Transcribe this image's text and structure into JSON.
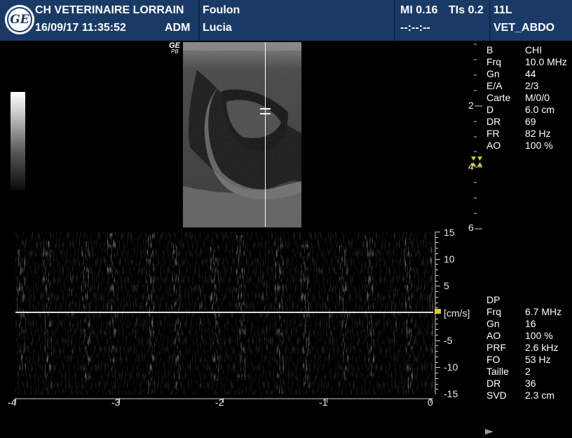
{
  "header": {
    "institution": "CH VETERINAIRE LORRAIN",
    "datetime": "16/09/17 11:35:52",
    "operator": "ADM",
    "patient_last": "Foulon",
    "patient_first": "Lucia",
    "mi_label": "MI 0.16",
    "tis_label": "TIs 0.2",
    "timer": "--:--:--",
    "probe": "11L",
    "preset": "VET_ABDO"
  },
  "image_marks": {
    "ge_mark": "GE",
    "pb_mark": "PB",
    "gate_symbol": "="
  },
  "bmode_params": [
    {
      "key": "B",
      "value": "CHI"
    },
    {
      "key": "Frq",
      "value": "10.0 MHz"
    },
    {
      "key": "Gn",
      "value": "44"
    },
    {
      "key": "E/A",
      "value": "2/3"
    },
    {
      "key": "Carte",
      "value": "M/0/0"
    },
    {
      "key": "D",
      "value": "6.0 cm"
    },
    {
      "key": "DR",
      "value": "69"
    },
    {
      "key": "FR",
      "value": "82 Hz"
    },
    {
      "key": "AO",
      "value": "100 %"
    }
  ],
  "doppler_params": [
    {
      "key": "DP",
      "value": ""
    },
    {
      "key": "Frq",
      "value": "6.7 MHz"
    },
    {
      "key": "Gn",
      "value": "16"
    },
    {
      "key": "AO",
      "value": "100 %"
    },
    {
      "key": "PRF",
      "value": "2.6 kHz"
    },
    {
      "key": "FO",
      "value": "53 Hz"
    },
    {
      "key": "Taille",
      "value": "2"
    },
    {
      "key": "DR",
      "value": "36"
    },
    {
      "key": "SVD",
      "value": "2.3 cm"
    }
  ],
  "depth_scale": {
    "labels": [
      "2",
      "4",
      "6"
    ],
    "values_cm": [
      2,
      4,
      6
    ],
    "max_cm": 6
  },
  "velocity_scale": {
    "ticks": [
      15,
      10,
      5,
      -5,
      -10,
      -15
    ],
    "unit": "[cm/s]"
  },
  "time_axis": {
    "ticks": [
      "-4",
      "-3",
      "-2",
      "-1",
      "0"
    ]
  },
  "colors": {
    "header_bg": "#1a3a66",
    "scale_marker": "#d4cc3a",
    "baseline": "#e0e0c8",
    "axis": "#d0d0d0"
  }
}
